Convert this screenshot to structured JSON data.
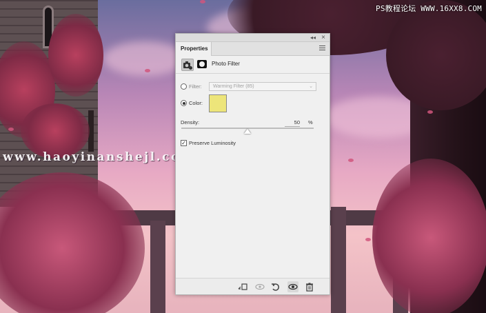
{
  "watermarks": {
    "top_right": "PS教程论坛 WWW.16XX8.COM",
    "middle": "www.haoyinanshejl.com"
  },
  "panel": {
    "tab_label": "Properties",
    "adjustment_title": "Photo Filter",
    "filter_label": "Filter:",
    "filter_value": "Warming Filter (85)",
    "filter_selected": false,
    "color_label": "Color:",
    "color_selected": true,
    "color_value": "#ede57a",
    "density_label": "Density:",
    "density_value": "50",
    "density_unit": "%",
    "density_fraction": 0.5,
    "preserve_luminosity_label": "Preserve Luminosity",
    "preserve_luminosity_checked": true,
    "footer_icons": [
      "clip-to-layer-icon",
      "view-previous-icon",
      "reset-icon",
      "visibility-icon",
      "delete-icon"
    ]
  }
}
